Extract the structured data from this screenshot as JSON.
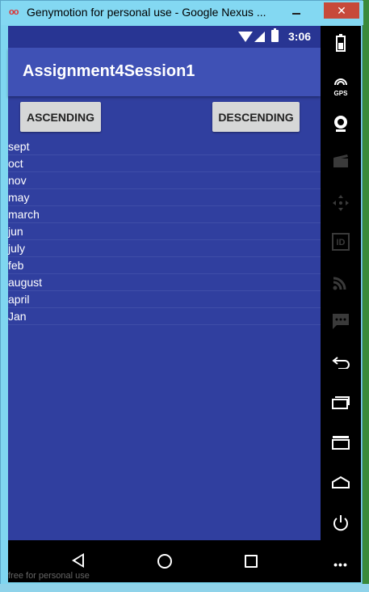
{
  "window": {
    "title": "Genymotion for personal use - Google Nexus ...",
    "close_label": "✕"
  },
  "statusbar": {
    "time": "3:06"
  },
  "app": {
    "title": "Assignment4Session1"
  },
  "buttons": {
    "ascending": "ASCENDING",
    "descending": "DESCENDING"
  },
  "list": {
    "items": [
      "sept",
      "oct",
      "nov",
      "may",
      "march",
      "jun",
      "july",
      "feb",
      "august",
      "april",
      "Jan"
    ]
  },
  "sidebar": {
    "gps_label": "GPS",
    "id_label": "ID",
    "more_label": "•••"
  },
  "watermark": "free for personal use",
  "colors": {
    "primary": "#3f51b5",
    "primary_dark": "#283593",
    "background": "#303f9f"
  }
}
